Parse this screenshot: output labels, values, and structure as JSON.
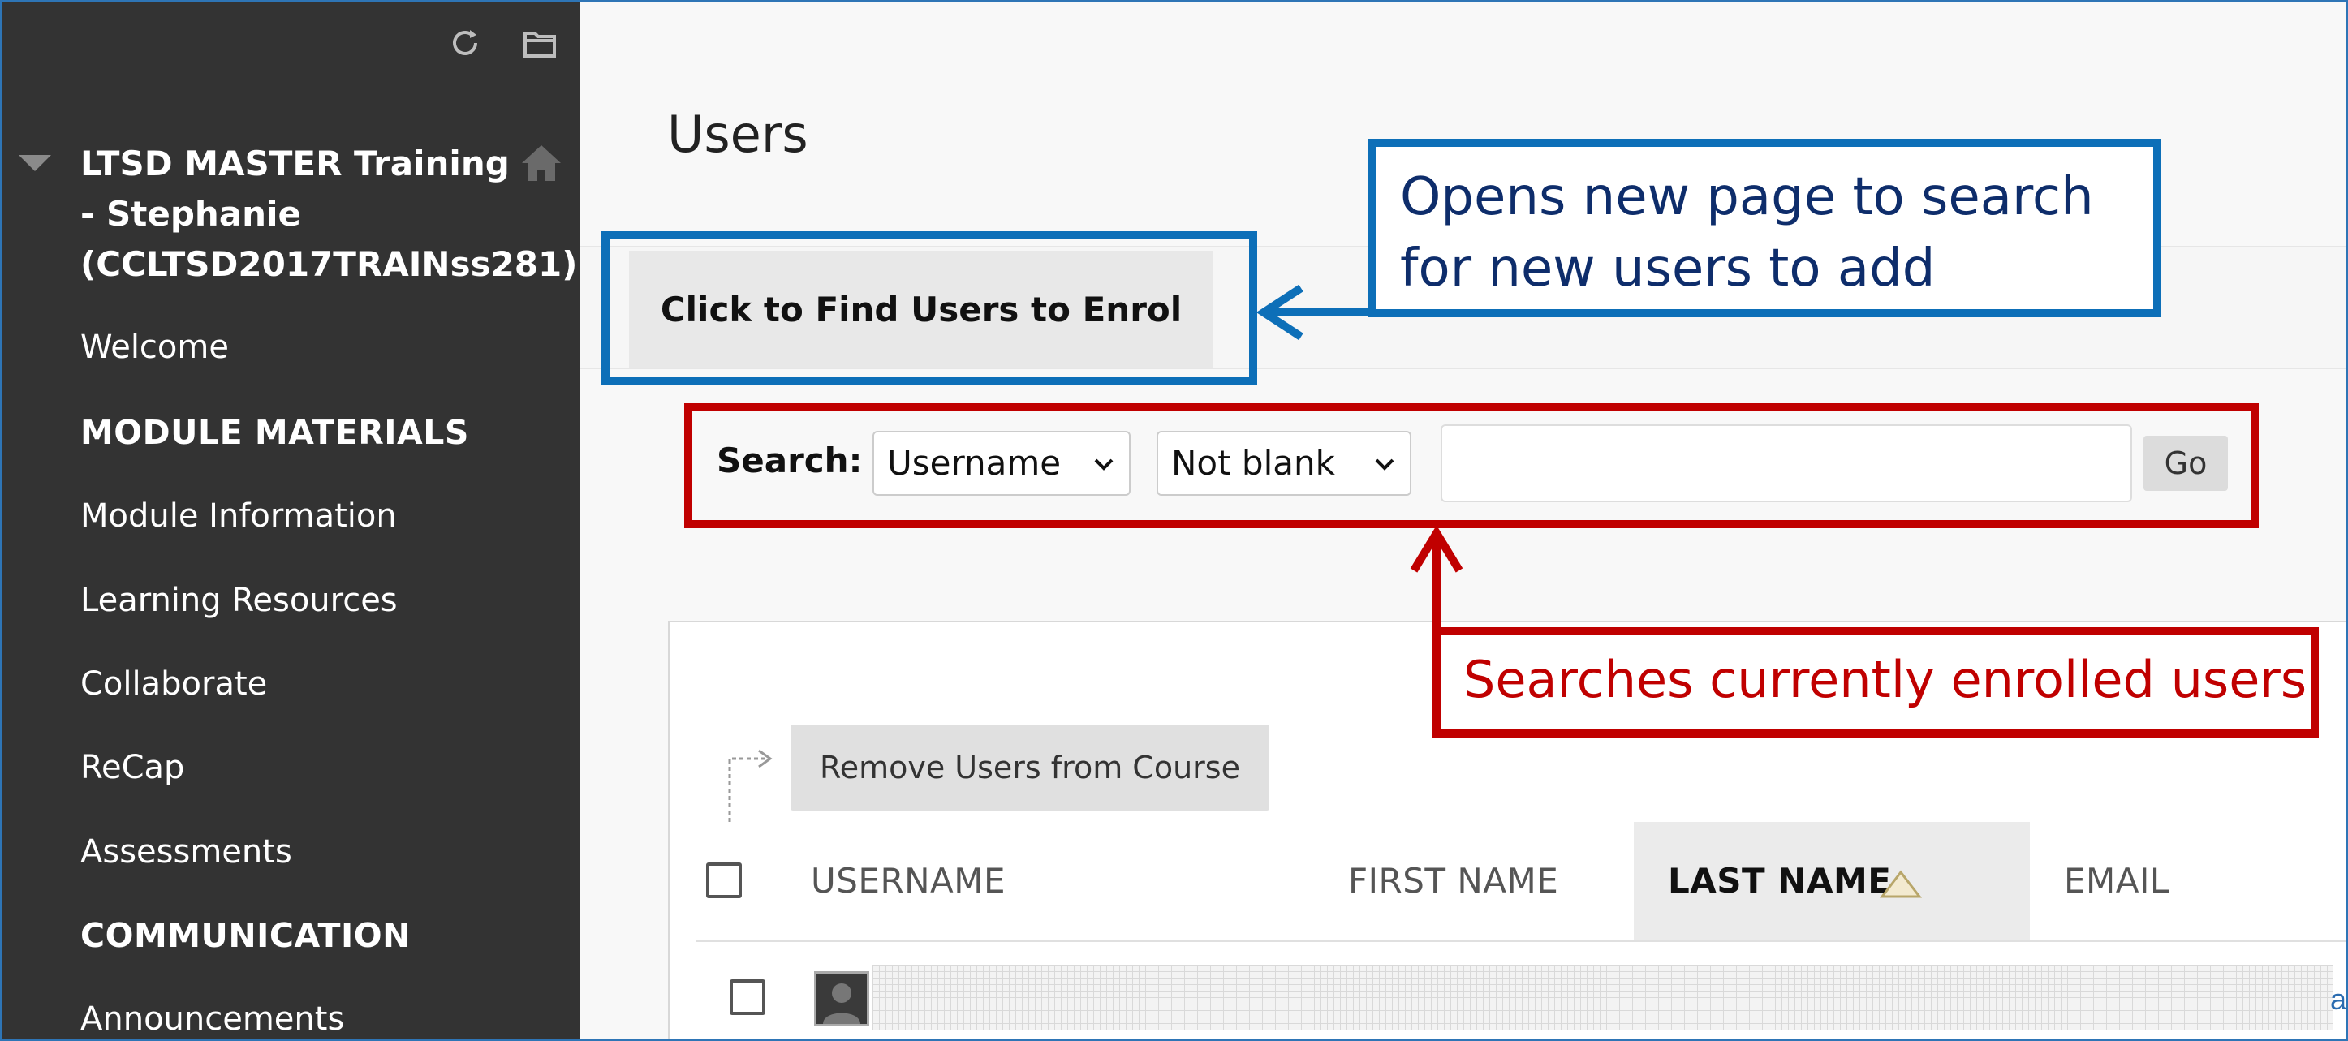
{
  "sidebar": {
    "course_title": "LTSD MASTER Training - Stephanie (CCLTSD2017TRAINss281)",
    "items": [
      {
        "label": "Welcome",
        "type": "link"
      },
      {
        "label": "MODULE MATERIALS",
        "type": "heading"
      },
      {
        "label": "Module Information",
        "type": "link"
      },
      {
        "label": "Learning Resources",
        "type": "link"
      },
      {
        "label": "Collaborate",
        "type": "link"
      },
      {
        "label": "ReCap",
        "type": "link"
      },
      {
        "label": "Assessments",
        "type": "link"
      },
      {
        "label": "COMMUNICATION",
        "type": "heading"
      },
      {
        "label": "Announcements",
        "type": "link"
      }
    ],
    "tool_icons": [
      "refresh-icon",
      "folder-icon"
    ],
    "home_icon": "home-icon"
  },
  "main": {
    "page_title": "Users",
    "find_users_button": "Click to Find Users to Enrol",
    "search": {
      "label": "Search:",
      "field_selected": "Username",
      "operator_selected": "Not blank",
      "value": "",
      "go_label": "Go"
    },
    "remove_button": "Remove Users from Course",
    "columns": [
      "USERNAME",
      "FIRST NAME",
      "LAST NAME",
      "EMAIL"
    ],
    "sorted_column": "LAST NAME",
    "row_edge_text": "ar"
  },
  "annotations": {
    "find_users_note": "Opens new page to search for new users to add",
    "search_note": "Searches currently enrolled users",
    "blue_color": "#0d6fb8",
    "red_color": "#c00000"
  }
}
